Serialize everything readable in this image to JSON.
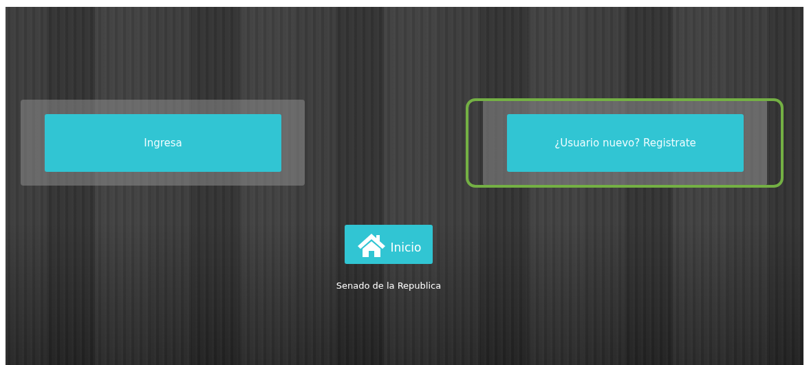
{
  "panels": [
    {
      "button": "Ingresa",
      "highlighted": false
    },
    {
      "button": "¿Usuario nuevo? Registrate",
      "highlighted": true
    }
  ],
  "home_button": {
    "label": "Inicio"
  },
  "footer": "Senado de la Republica"
}
